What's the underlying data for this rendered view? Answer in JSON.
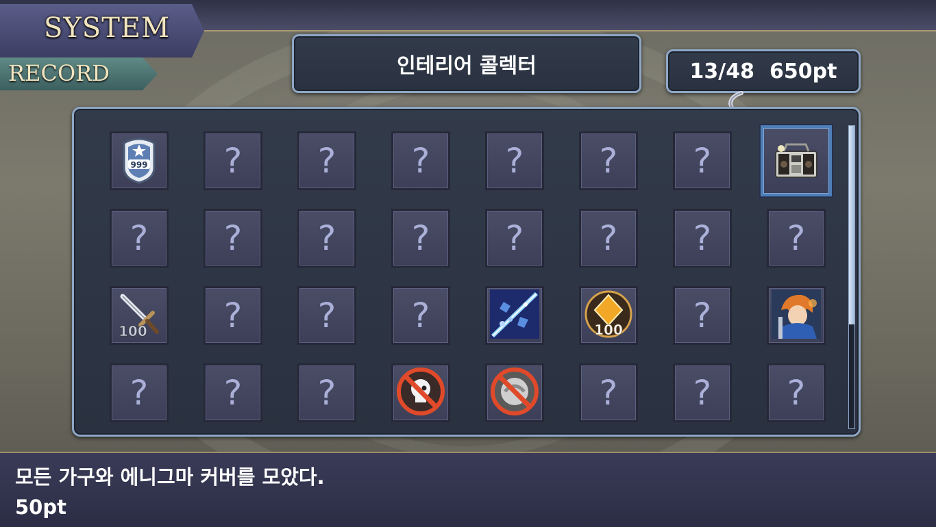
{
  "header": {
    "system_label": "SYSTEM",
    "record_label": "RECORD"
  },
  "collection": {
    "title": "인테리어 콜렉터",
    "progress": "13/48",
    "points": "650pt"
  },
  "grid": {
    "unknown_symbol": "?",
    "cells": [
      {
        "icon": "badge-icon",
        "label": "999"
      },
      {
        "icon": "unknown"
      },
      {
        "icon": "unknown"
      },
      {
        "icon": "unknown"
      },
      {
        "icon": "unknown"
      },
      {
        "icon": "unknown"
      },
      {
        "icon": "unknown"
      },
      {
        "icon": "boombox-icon",
        "selected": true
      },
      {
        "icon": "unknown"
      },
      {
        "icon": "unknown"
      },
      {
        "icon": "unknown"
      },
      {
        "icon": "unknown"
      },
      {
        "icon": "unknown"
      },
      {
        "icon": "unknown"
      },
      {
        "icon": "unknown"
      },
      {
        "icon": "unknown"
      },
      {
        "icon": "sword-icon",
        "label": "100"
      },
      {
        "icon": "unknown"
      },
      {
        "icon": "unknown"
      },
      {
        "icon": "unknown"
      },
      {
        "icon": "crystal-shatter-icon"
      },
      {
        "icon": "diamond-medal-icon",
        "label": "100"
      },
      {
        "icon": "unknown"
      },
      {
        "icon": "character-portrait-icon"
      },
      {
        "icon": "unknown"
      },
      {
        "icon": "unknown"
      },
      {
        "icon": "unknown"
      },
      {
        "icon": "no-skull-icon"
      },
      {
        "icon": "no-shield-icon"
      },
      {
        "icon": "unknown"
      },
      {
        "icon": "unknown"
      },
      {
        "icon": "unknown"
      }
    ]
  },
  "description": {
    "text": "모든 가구와 에니그마 커버를 모았다.",
    "points": "50pt"
  },
  "colors": {
    "panel_border": "#8fa7c5",
    "cell_bg": "#434660",
    "question_mark": "#aab0d8",
    "selected_border": "#4f7fb8"
  }
}
